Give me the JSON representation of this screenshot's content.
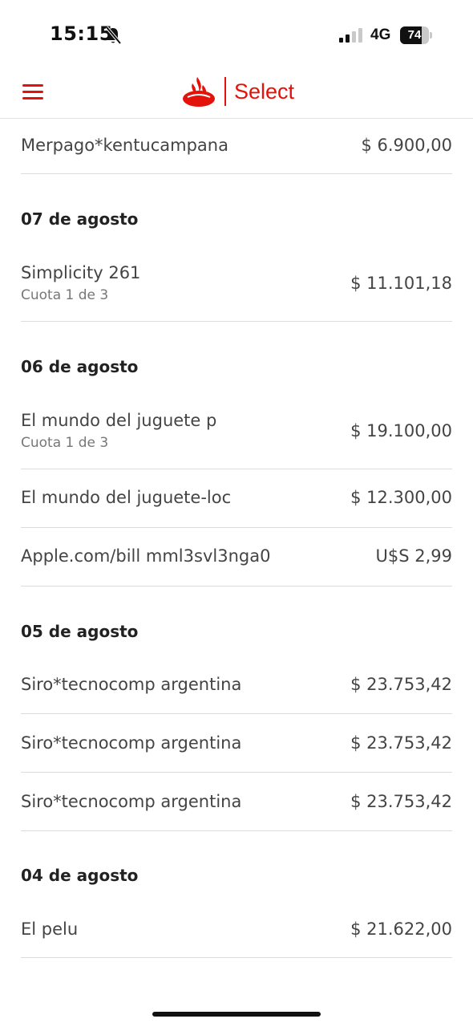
{
  "status_bar": {
    "time": "15:15",
    "network": "4G",
    "battery": "74",
    "battery_level": 0.74,
    "bell_icon": "bell-slash-icon",
    "signal_icon": "cellular-signal-icon"
  },
  "header": {
    "menu_icon": "hamburger-menu-icon",
    "logo_icon": "santander-flame-logo",
    "brand": "Select",
    "accent_color": "#e3120b"
  },
  "transactions": {
    "top_item": {
      "description": "Merpago*kentucampana",
      "amount": "$ 6.900,00"
    },
    "groups": [
      {
        "date": "07 de agosto",
        "items": [
          {
            "description": "Simplicity 261",
            "installment": "Cuota 1 de 3",
            "amount": "$ 11.101,18"
          }
        ]
      },
      {
        "date": "06 de agosto",
        "items": [
          {
            "description": "El mundo del juguete p",
            "installment": "Cuota 1 de 3",
            "amount": "$ 19.100,00"
          },
          {
            "description": "El mundo del juguete-loc",
            "amount": "$ 12.300,00"
          },
          {
            "description": "Apple.com/bill mml3svl3nga0",
            "amount": "U$S 2,99"
          }
        ]
      },
      {
        "date": "05 de agosto",
        "items": [
          {
            "description": "Siro*tecnocomp argentina",
            "amount": "$ 23.753,42"
          },
          {
            "description": "Siro*tecnocomp argentina",
            "amount": "$ 23.753,42"
          },
          {
            "description": "Siro*tecnocomp argentina",
            "amount": "$ 23.753,42"
          }
        ]
      },
      {
        "date": "04 de agosto",
        "items": [
          {
            "description": "El pelu",
            "amount": "$ 21.622,00"
          }
        ]
      }
    ]
  }
}
